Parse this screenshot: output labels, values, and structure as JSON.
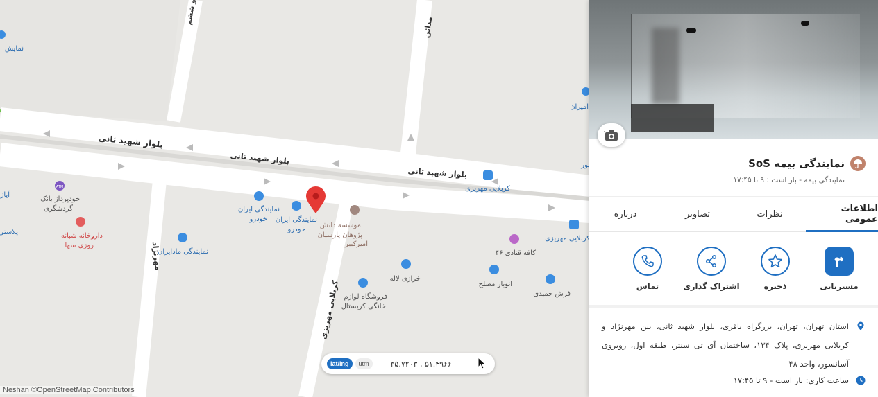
{
  "map": {
    "roads": {
      "boulevard_upper": "بلوار شهید ثانی",
      "boulevard_lower": "بلوار شهید ثانی",
      "boulevard_right": "بلوار شهید ثانی",
      "mehrnejad": "مهرنژاد",
      "madaen": "مدائن",
      "karbalaei": "کربلایی مهریزی",
      "top_street": "و ششم"
    },
    "pois": [
      {
        "label": "نمایش"
      },
      {
        "label": "امیران"
      },
      {
        "label": "آیاز"
      },
      {
        "label": "پلاستی"
      },
      {
        "label": "خودپرداز بانک",
        "label2": "گردشگری"
      },
      {
        "label": "داروخانه شبانه",
        "label2": "روزی سها"
      },
      {
        "label": "نمایندگی ایران",
        "label2": "خودرو"
      },
      {
        "label": "نمایندگی ایران",
        "label2": "خودرو"
      },
      {
        "label": "نمایندگی مادایران"
      },
      {
        "label": "موسسه دانش",
        "label2": "پژوهان پارسیان",
        "label3": "امیرکبیر"
      },
      {
        "label": "کربلایی مهریزی"
      },
      {
        "label": "کربلایی مهریزی"
      },
      {
        "label": "کافه قنادی ۴۶"
      },
      {
        "label": "خرازی لاله"
      },
      {
        "label": "اتوبار مصلح"
      },
      {
        "label": "فرش حمیدی"
      },
      {
        "label": "فروشگاه لوازم",
        "label2": "خانگی کریستال"
      },
      {
        "label": "ATM"
      },
      {
        "label": "پور"
      }
    ],
    "attribution": "Neshan ©OpenStreetMap Contributors",
    "coordinates": {
      "mode_active": "lat/lng",
      "mode_inactive": "utm",
      "value": "۳۵.۷۲۰۳ , ۵۱.۴۹۶۶"
    }
  },
  "panel": {
    "title": "نمایندگی بیمه SoS",
    "subtitle": "نمایندگی بیمه - باز است : ۹ تا ۱۷:۴۵",
    "tabs": [
      "اطلاعات عمومی",
      "نظرات",
      "تصاویر",
      "درباره"
    ],
    "active_tab": 0,
    "actions": [
      {
        "label": "مسیریابی",
        "icon": "directions-icon"
      },
      {
        "label": "ذخیره",
        "icon": "star-icon"
      },
      {
        "label": "اشتراک گذاری",
        "icon": "share-icon"
      },
      {
        "label": "تماس",
        "icon": "phone-icon"
      }
    ],
    "address": "استان تهران، تهران، بزرگراه باقری، بلوار شهید ثانی، بین مهرنژاد و کربلایی مهریزی، پلاک ۱۳۴، ساختمان آی تی سنتر، طبقه اول، روبروی آسانسور، واحد ۴۸",
    "hours": "ساعت کاری: باز است - ۹ تا ۱۷:۴۵"
  },
  "colors": {
    "accent": "#1f6fc2",
    "marker": "#e53935",
    "park_line": "#6cc04a"
  }
}
